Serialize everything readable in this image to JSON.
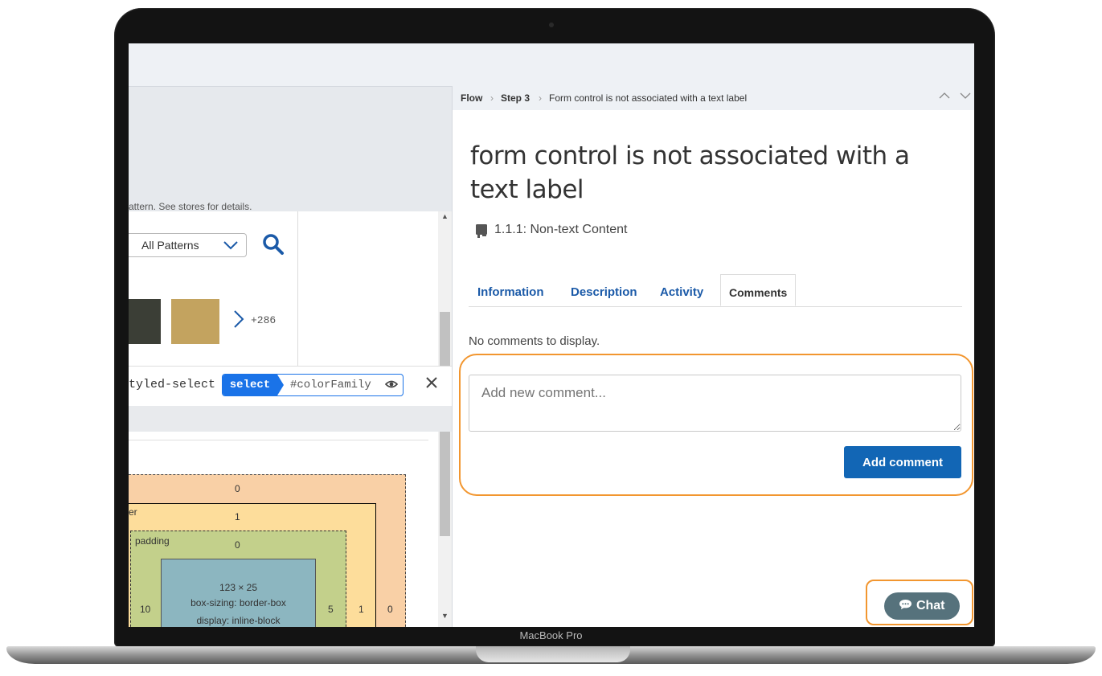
{
  "device": {
    "label": "MacBook Pro"
  },
  "left_panel": {
    "cutoff_text": "attern. See stores for details.",
    "pattern_select": {
      "value": "All Patterns"
    },
    "more_count": "+286",
    "selector": {
      "prefix": "tyled-select",
      "tag": "select",
      "id": "#colorFamily"
    },
    "box_model": {
      "margin_label": "",
      "margin_top": "0",
      "border_label": "er",
      "border_top": "1",
      "padding_label": "padding",
      "padding_top": "0",
      "content_size": "123 × 25",
      "content_box_sizing": "box-sizing: border-box",
      "content_display": "display: inline-block",
      "padding_left": "10",
      "padding_right": "5",
      "border_right": "1",
      "margin_right": "0"
    },
    "colors": {
      "swatch_dark": "#3b3e36",
      "swatch_tan": "#c3a35f"
    }
  },
  "issue_panel": {
    "breadcrumb": [
      {
        "label": "Flow",
        "bold": true
      },
      {
        "label": "Step 3",
        "bold": true
      },
      {
        "label": "Form control is not associated with a text label",
        "bold": false
      }
    ],
    "title": "form control is not associated with a text label",
    "criterion": "1.1.1: Non-text Content",
    "tabs": [
      {
        "label": "Information",
        "active": false
      },
      {
        "label": "Description",
        "active": false
      },
      {
        "label": "Activity",
        "active": false
      },
      {
        "label": "Comments",
        "active": true
      }
    ],
    "empty_message": "No comments to display.",
    "comment_placeholder": "Add new comment...",
    "add_comment_label": "Add comment",
    "chat_label": "Chat",
    "colors": {
      "accent": "#1266b5",
      "highlight": "#f2962f",
      "chat": "#56727c"
    }
  }
}
